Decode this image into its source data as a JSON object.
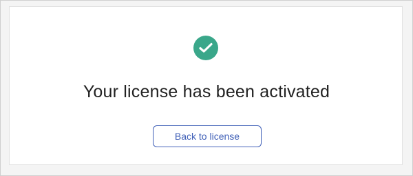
{
  "dialog": {
    "title": "Your license has been activated",
    "back_button_label": "Back to license"
  },
  "icons": {
    "status": "check-circle-icon"
  },
  "colors": {
    "success": "#3aa78a",
    "button_accent": "#3f5fb7",
    "title_text": "#222222"
  }
}
